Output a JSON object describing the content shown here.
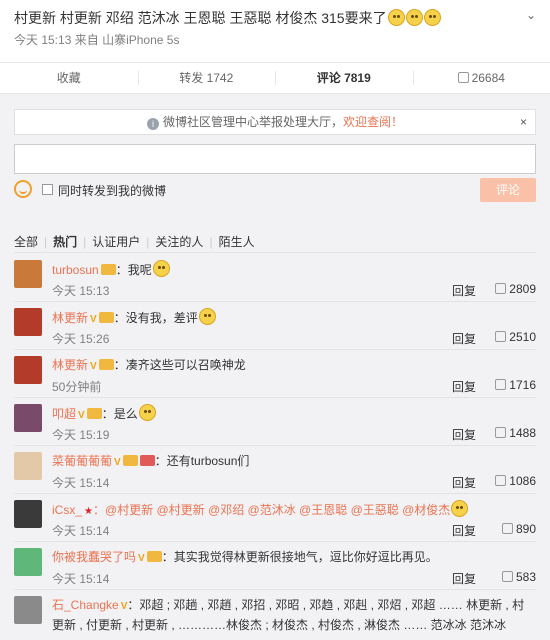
{
  "post": {
    "text": "村更新 村更新 邓绍 范沐冰 王恩聪 王惡聪 材俊杰 315要来了",
    "time": "今天 15:13",
    "source_prefix": "来自",
    "source": "山寨iPhone 5s"
  },
  "actions": {
    "collect": "收藏",
    "repost": "转发 1742",
    "comment": "评论 7819",
    "like": "26684"
  },
  "notice": {
    "text": "微博社区管理中心举报处理大厅，",
    "link": "欢迎查阅！",
    "close": "×"
  },
  "composer": {
    "placeholder": "",
    "repost_label": "同时转发到我的微博",
    "submit_label": "评论"
  },
  "filters": [
    "全部",
    "热门",
    "认证用户",
    "关注的人",
    "陌生人"
  ],
  "comments": [
    {
      "user": "turbosun",
      "text": "：我呢",
      "time": "今天 15:13",
      "reply": "回复",
      "likes": "2809",
      "avatar_color": "#c9793a"
    },
    {
      "user": "林更新",
      "text": "：没有我，差评",
      "time": "今天 15:26",
      "reply": "回复",
      "likes": "2510",
      "avatar_color": "#b23b2a"
    },
    {
      "user": "林更新",
      "text": "：凑齐这些可以召唤神龙",
      "time": "50分钟前",
      "reply": "回复",
      "likes": "1716",
      "avatar_color": "#b23b2a"
    },
    {
      "user": "叩超",
      "text": "：是么",
      "time": "今天 15:19",
      "reply": "回复",
      "likes": "1488",
      "avatar_color": "#7a4a6a"
    },
    {
      "user": "菜葡葡葡葡",
      "text": "：还有turbosun们",
      "time": "今天 15:14",
      "reply": "回复",
      "likes": "1086",
      "avatar_color": "#e3c9a8"
    },
    {
      "user": "iCsx_",
      "text": "：@村更新 @村更新 @邓绍 @范沐冰 @王恩聪 @王惡聪 @材俊杰",
      "time": "今天 15:14",
      "reply": "回复",
      "likes": "890",
      "avatar_color": "#3a3a3a"
    },
    {
      "user": "你被我蠢哭了吗",
      "text": "：其实我觉得林更新很接地气，逗比你好逗比再见。",
      "time": "今天 15:14",
      "reply": "回复",
      "likes": "583",
      "avatar_color": "#5fb87a"
    },
    {
      "user": "石_Changke",
      "text": "：邓超 ; 邓趟 , 邓趙 , 邓招 , 邓昭 , 邓趋 , 邓赳 , 邓炤 , 邓超 …… 林更新 , 村更新 , 付更新 , 村更新 , …………林俊杰 ; 材俊杰 , 村俊杰 , 淋俊杰 …… 范冰冰 范沐冰",
      "time": "",
      "reply": "",
      "likes": "",
      "avatar_color": "#8a8a8a"
    }
  ],
  "colors": {
    "accent": "#eb7350",
    "badge": "#f1a30c",
    "submit": "#fbc1a8"
  }
}
